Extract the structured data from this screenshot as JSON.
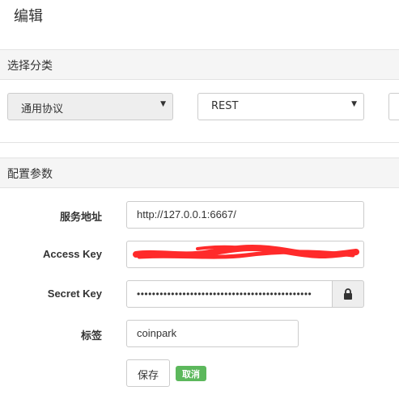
{
  "page": {
    "title": "编辑"
  },
  "category_section": {
    "header": "选择分类",
    "protocol_select": {
      "value": "通用协议",
      "disabled": true
    },
    "type_select": {
      "value": "REST"
    }
  },
  "params_section": {
    "header": "配置参数",
    "service_address": {
      "label": "服务地址",
      "value": "http://127.0.0.1:6667/"
    },
    "access_key": {
      "label": "Access Key",
      "value": ""
    },
    "secret_key": {
      "label": "Secret Key",
      "value": "••••••••••••••••••••••••••••••••••••••••••••••",
      "addon_icon": "lock-icon"
    },
    "tag": {
      "label": "标签",
      "value": "coinpark"
    }
  },
  "actions": {
    "save_label": "保存",
    "cancel_label": "取消"
  },
  "colors": {
    "cancel_bg": "#5cb85c",
    "redaction": "#ff2a2a",
    "header_bg": "#f5f5f5"
  }
}
